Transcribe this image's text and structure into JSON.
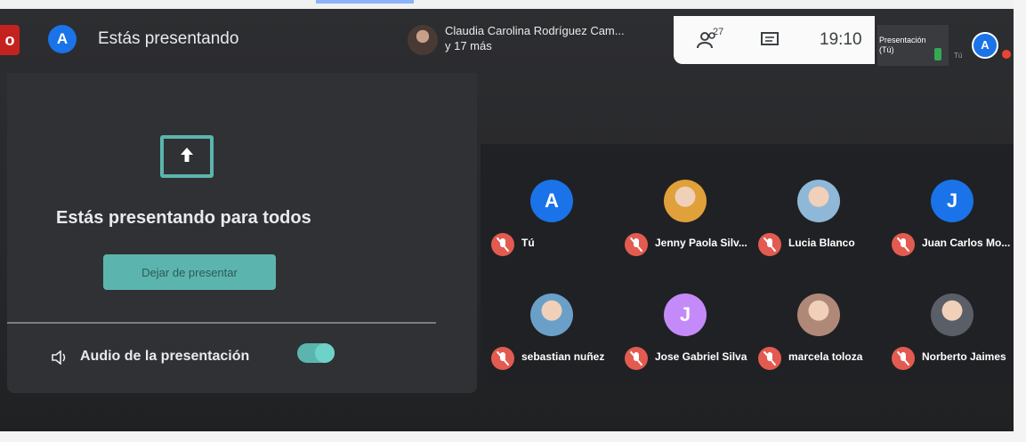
{
  "header": {
    "presenting_label": "Estás presentando",
    "user_initial": "A",
    "presenter_name": "Claudia Carolina Rodríguez Cam...",
    "presenter_more": "y 17 más",
    "tab_glyph": "o"
  },
  "controls": {
    "people_count": "27",
    "time": "19:10"
  },
  "self_view": {
    "label": "Presentación (Tú)",
    "tag": "Tú",
    "initial": "A"
  },
  "presenting_panel": {
    "title": "Estás presentando para todos",
    "stop_button": "Dejar de presentar",
    "audio_label": "Audio de la presentación",
    "audio_enabled": true
  },
  "participants": [
    {
      "name": "Tú",
      "initial": "A",
      "avatar_color": "#1a73e8",
      "photo": false,
      "muted": true
    },
    {
      "name": "Jenny Paola Silv...",
      "initial": "",
      "avatar_color": "#e0a03a",
      "photo": true,
      "muted": true
    },
    {
      "name": "Lucia Blanco",
      "initial": "",
      "avatar_color": "#8fb8d8",
      "photo": true,
      "muted": true
    },
    {
      "name": "Juan Carlos Mo...",
      "initial": "J",
      "avatar_color": "#1a73e8",
      "photo": false,
      "muted": true
    },
    {
      "name": "sebastian nuñez",
      "initial": "",
      "avatar_color": "#6aa0c8",
      "photo": true,
      "muted": true
    },
    {
      "name": "Jose Gabriel Silva",
      "initial": "J",
      "avatar_color": "#c58af9",
      "photo": false,
      "muted": true
    },
    {
      "name": "marcela toloza",
      "initial": "",
      "avatar_color": "#b08878",
      "photo": true,
      "muted": true
    },
    {
      "name": "Norberto Jaimes",
      "initial": "",
      "avatar_color": "#5a5e66",
      "photo": true,
      "muted": true
    }
  ],
  "colors": {
    "accent_teal": "#5bb5ae",
    "mic_off_red": "#e35b50",
    "brand_blue": "#1a73e8"
  }
}
